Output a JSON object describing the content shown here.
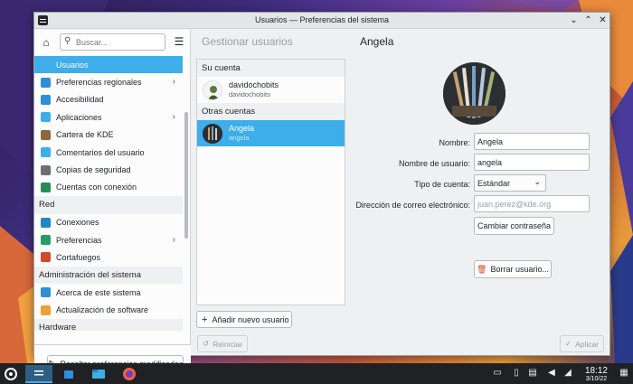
{
  "window": {
    "title": "Usuarios — Preferencias del sistema"
  },
  "sidebar": {
    "search_placeholder": "Buscar...",
    "items": [
      {
        "type": "item",
        "label": "Usuarios",
        "active": true,
        "color": "#3daee9"
      },
      {
        "type": "item",
        "label": "Preferencias regionales",
        "arrow": true,
        "color": "#2c8fd9"
      },
      {
        "type": "item",
        "label": "Accesibilidad",
        "color": "#2c8fd9"
      },
      {
        "type": "item",
        "label": "Aplicaciones",
        "arrow": true,
        "color": "#3daee9"
      },
      {
        "type": "item",
        "label": "Cartera de KDE",
        "color": "#8a6a3a"
      },
      {
        "type": "item",
        "label": "Comentarios del usuario",
        "color": "#3daee9"
      },
      {
        "type": "item",
        "label": "Copias de seguridad",
        "color": "#6b6f73"
      },
      {
        "type": "item",
        "label": "Cuentas con conexión",
        "color": "#2a8a5a"
      },
      {
        "type": "header",
        "label": "Red"
      },
      {
        "type": "item",
        "label": "Conexiones",
        "color": "#1e88c8"
      },
      {
        "type": "item",
        "label": "Preferencias",
        "arrow": true,
        "color": "#2a9a6a"
      },
      {
        "type": "item",
        "label": "Cortafuegos",
        "color": "#d24a2a"
      },
      {
        "type": "header",
        "label": "Administración del sistema"
      },
      {
        "type": "item",
        "label": "Acerca de este sistema",
        "color": "#2c8fd9"
      },
      {
        "type": "item",
        "label": "Actualización de software",
        "color": "#e8a23a"
      },
      {
        "type": "header",
        "label": "Hardware"
      }
    ],
    "footer_button": "Resaltar preferencias modificadas"
  },
  "page": {
    "crumb": "Gestionar usuarios",
    "title": "Angela"
  },
  "accounts": {
    "your_account_header": "Su cuenta",
    "your_account": {
      "name": "davidochobits",
      "user": "davidochobits"
    },
    "others_header": "Otras cuentas",
    "others": [
      {
        "name": "Angela",
        "user": "angela"
      }
    ],
    "add_button": "Añadir nuevo usuario"
  },
  "form": {
    "name_label": "Nombre:",
    "name_value": "Angela",
    "username_label": "Nombre de usuario:",
    "username_value": "angela",
    "type_label": "Tipo de cuenta:",
    "type_value": "Estándar",
    "email_label": "Dirección de correo electrónico:",
    "email_placeholder": "juan.perez@kde.org",
    "change_password": "Cambiar contraseña",
    "delete_user": "Borrar usuario..."
  },
  "footer": {
    "reset": "Reiniciar",
    "apply": "Aplicar"
  },
  "taskbar": {
    "time": "18:12",
    "date": "3/10/22"
  }
}
